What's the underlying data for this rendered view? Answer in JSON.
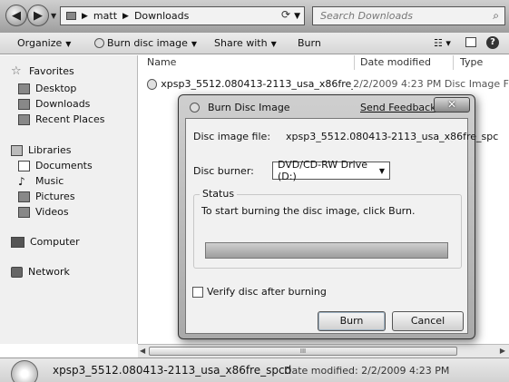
{
  "address": {
    "path": [
      "matt",
      "Downloads"
    ]
  },
  "search": {
    "placeholder": "Search Downloads"
  },
  "toolbar": {
    "organize": "Organize",
    "burn_disc_image": "Burn disc image",
    "share_with": "Share with",
    "burn": "Burn"
  },
  "nav": {
    "favorites": "Favorites",
    "desktop": "Desktop",
    "downloads": "Downloads",
    "recent_places": "Recent Places",
    "libraries": "Libraries",
    "documents": "Documents",
    "music": "Music",
    "pictures": "Pictures",
    "videos": "Videos",
    "computer": "Computer",
    "network": "Network"
  },
  "columns": {
    "name": "Name",
    "date_modified": "Date modified",
    "type": "Type"
  },
  "files": [
    {
      "name": "xpsp3_5512.080413-2113_usa_x86fre_spcd",
      "date": "2/2/2009 4:23 PM",
      "type": "Disc Image F"
    }
  ],
  "details": {
    "name": "xpsp3_5512.080413-2113_usa_x86fre_spcd",
    "date_modified": "Date modified: 2/2/2009 4:23 PM"
  },
  "dialog": {
    "title": "Burn Disc Image",
    "send_feedback": "Send Feedback",
    "close": "✕",
    "file_label": "Disc image file:",
    "file_value": "xpsp3_5512.080413-2113_usa_x86fre_spc",
    "burner_label": "Disc burner:",
    "burner_value": "DVD/CD-RW Drive (D:)",
    "status_title": "Status",
    "status_text": "To start burning the disc image, click Burn.",
    "progress": 1.0,
    "verify_label": "Verify disc after burning",
    "verify_checked": false,
    "burn_button": "Burn",
    "cancel_button": "Cancel"
  },
  "scrollbar": {
    "grip": "III"
  }
}
